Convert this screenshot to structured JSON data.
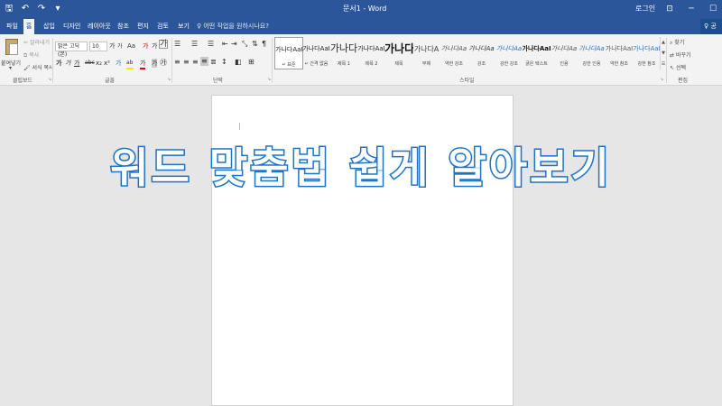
{
  "titlebar": {
    "qat": {
      "save": "🖫",
      "undo": "↶",
      "redo": "↷",
      "customize": "▾"
    },
    "doc_title": "문서1 - Word",
    "signin": "로그인",
    "win": {
      "ribbon_opts": "⊡",
      "minimize": "─",
      "maximize": "☐",
      "close": "✕"
    }
  },
  "tabs": [
    "파일",
    "홈",
    "삽입",
    "디자인",
    "레이아웃",
    "참조",
    "편지",
    "검토",
    "보기"
  ],
  "tellme": "어떤 작업을 원하시나요?",
  "share": "♀ 공유",
  "clipboard": {
    "paste": "붙여넣기",
    "cut": "잘라내기",
    "copy": "복사",
    "format_painter": "서식 복사",
    "label": "클립보드"
  },
  "font": {
    "name": "맑은 고딕(본)",
    "size": "10",
    "grow": "가",
    "shrink": "가",
    "case": "Aa",
    "clear": "가",
    "bold": "가",
    "italic": "가",
    "underline": "가",
    "strike": "abc",
    "sub": "x₂",
    "sup": "x²",
    "effects": "가",
    "highlight": "ab",
    "color": "가",
    "shade": "가",
    "border": "가",
    "enclose": "㉮",
    "label": "글꼴"
  },
  "paragraph": {
    "label": "단락"
  },
  "styles": {
    "label": "스타일",
    "items": [
      {
        "sample": "가나다AaI",
        "name": "↵ 표준",
        "size": "7px",
        "color": "#222"
      },
      {
        "sample": "가나다AaI",
        "name": "↵ 간격 없음",
        "size": "7px",
        "color": "#222"
      },
      {
        "sample": "가나다",
        "name": "제목 1",
        "size": "11px",
        "color": "#222"
      },
      {
        "sample": "가나다AaI",
        "name": "제목 2",
        "size": "7px",
        "color": "#222"
      },
      {
        "sample": "가나다",
        "name": "제목",
        "size": "12px",
        "color": "#111"
      },
      {
        "sample": "가나다A",
        "name": "부제",
        "size": "8px",
        "color": "#444"
      },
      {
        "sample": "가나다Aa",
        "name": "약한 강조",
        "size": "7px",
        "color": "#555"
      },
      {
        "sample": "가나다Aa",
        "name": "강조",
        "size": "7px",
        "color": "#333"
      },
      {
        "sample": "가나다Aa",
        "name": "강한 강조",
        "size": "7px",
        "color": "#2e74b5"
      },
      {
        "sample": "가나다AaI",
        "name": "굵은 텍스트",
        "size": "7px",
        "color": "#111"
      },
      {
        "sample": "가나다Aa",
        "name": "인용",
        "size": "7px",
        "color": "#555"
      },
      {
        "sample": "가나다Aa",
        "name": "강한 인용",
        "size": "7px",
        "color": "#2e74b5"
      },
      {
        "sample": "가나다AaI",
        "name": "약한 참조",
        "size": "7px",
        "color": "#555"
      },
      {
        "sample": "가나다AaI",
        "name": "강한 참조",
        "size": "7px",
        "color": "#2e74b5"
      }
    ]
  },
  "editing": {
    "find": "찾기",
    "replace": "바꾸기",
    "select": "선택",
    "label": "편집"
  },
  "overlay_text": "워드 맞춤법 쉽게 알아보기",
  "colors": {
    "accent": "#2b579a",
    "overlay_stroke": "#1f74c6"
  }
}
